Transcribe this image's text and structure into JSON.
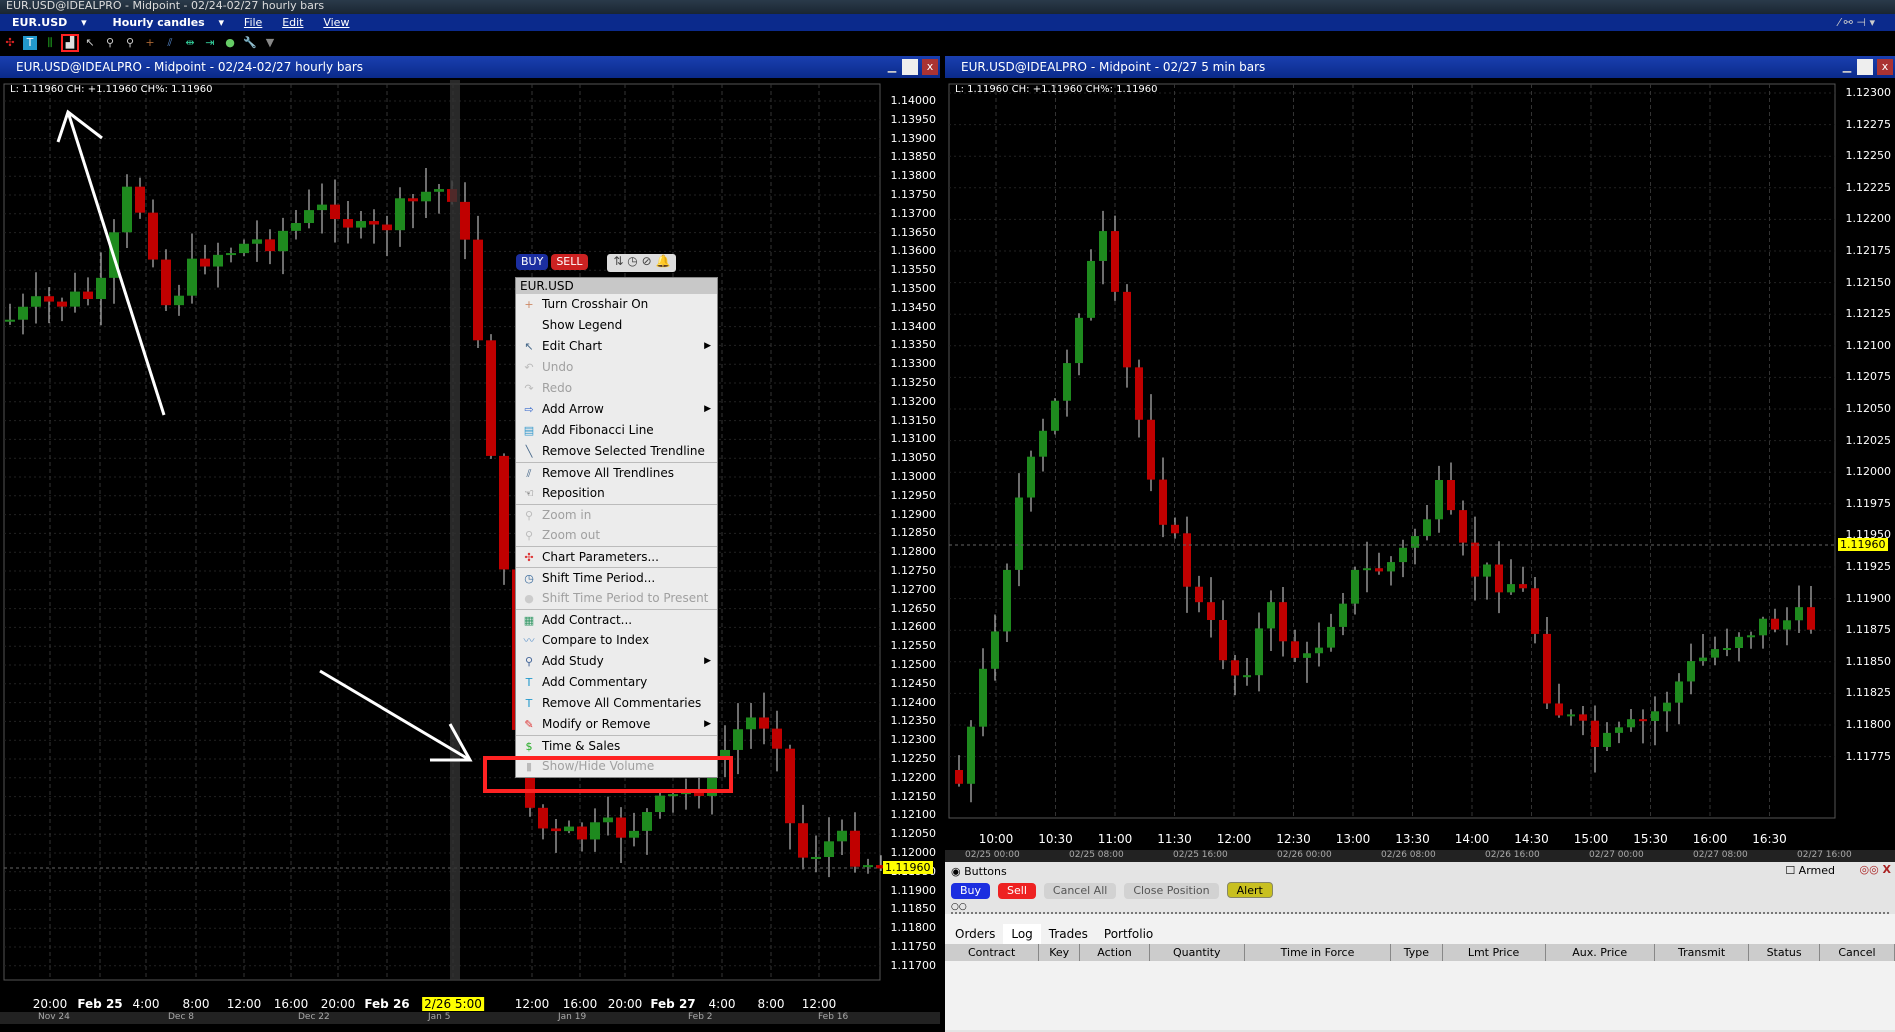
{
  "app": {
    "title": "EUR.USD@IDEALPRO - Midpoint - 02/24-02/27 hourly bars"
  },
  "menubar": {
    "symbol": "EUR.USD",
    "period": "Hourly candles",
    "file": "File",
    "edit": "Edit",
    "view": "View"
  },
  "left_pane": {
    "title": "EUR.USD@IDEALPRO - Midpoint - 02/24-02/27 hourly bars",
    "legend": "L: 1.11960 CH: +1.11960 CH%: 1.11960",
    "price_tag": "1.11960",
    "cursor_time": "2/26 5:00",
    "prices": [
      "1.14000",
      "1.13950",
      "1.13900",
      "1.13850",
      "1.13800",
      "1.13750",
      "1.13700",
      "1.13650",
      "1.13600",
      "1.13550",
      "1.13500",
      "1.13450",
      "1.13400",
      "1.13350",
      "1.13300",
      "1.13250",
      "1.13200",
      "1.13150",
      "1.13100",
      "1.13050",
      "1.13000",
      "1.12950",
      "1.12900",
      "1.12850",
      "1.12800",
      "1.12750",
      "1.12700",
      "1.12650",
      "1.12600",
      "1.12550",
      "1.12500",
      "1.12450",
      "1.12400",
      "1.12350",
      "1.12300",
      "1.12250",
      "1.12200",
      "1.12150",
      "1.12100",
      "1.12050",
      "1.12000",
      "1.11950",
      "1.11900",
      "1.11850",
      "1.11800",
      "1.11750",
      "1.11700"
    ],
    "times": [
      {
        "t": "20:00"
      },
      {
        "t": "Feb 25",
        "b": true
      },
      {
        "t": "4:00"
      },
      {
        "t": "8:00"
      },
      {
        "t": "12:00"
      },
      {
        "t": "16:00"
      },
      {
        "t": "20:00"
      },
      {
        "t": "Feb 26",
        "b": true
      },
      {
        "t": ""
      },
      {
        "t": "12:00"
      },
      {
        "t": "16:00"
      },
      {
        "t": "20:00"
      },
      {
        "t": "Feb 27",
        "b": true
      },
      {
        "t": "4:00"
      },
      {
        "t": "8:00"
      },
      {
        "t": "12:00"
      }
    ],
    "nav": [
      "Nov 24",
      "Dec 8",
      "Dec 22",
      "Jan 5",
      "Jan 19",
      "Feb 2",
      "Feb 16"
    ]
  },
  "right_pane": {
    "title": "EUR.USD@IDEALPRO - Midpoint - 02/27 5 min bars",
    "legend": "L: 1.11960 CH: +1.11960 CH%: 1.11960",
    "price_tag": "1.11960",
    "prices": [
      "1.12300",
      "1.12275",
      "1.12250",
      "1.12225",
      "1.12200",
      "1.12175",
      "1.12150",
      "1.12125",
      "1.12100",
      "1.12075",
      "1.12050",
      "1.12025",
      "1.12000",
      "1.11975",
      "1.11950",
      "1.11925",
      "1.11900",
      "1.11875",
      "1.11850",
      "1.11825",
      "1.11800",
      "1.11775"
    ],
    "times": [
      "10:00",
      "10:30",
      "11:00",
      "11:30",
      "12:00",
      "12:30",
      "13:00",
      "13:30",
      "14:00",
      "14:30",
      "15:00",
      "15:30",
      "16:00",
      "16:30"
    ],
    "nav": [
      "02/25 00:00",
      "02/25 08:00",
      "02/25 16:00",
      "02/26 00:00",
      "02/26 08:00",
      "02/26 16:00",
      "02/27 00:00",
      "02/27 08:00",
      "02/27 16:00"
    ]
  },
  "order_bar": {
    "buy": "BUY",
    "sell": "SELL"
  },
  "context_menu": {
    "header": "EUR.USD",
    "items": [
      {
        "label": "Turn Crosshair On",
        "icon": "crosshair-icon",
        "g": "+",
        "c": "#c86",
        "sep": false
      },
      {
        "label": "Show Legend",
        "icon": "",
        "g": "",
        "c": "#000"
      },
      {
        "label": "Edit Chart",
        "icon": "edit-chart-icon",
        "g": "↖",
        "c": "#468",
        "sub": true
      },
      {
        "label": "Undo",
        "icon": "undo-icon",
        "g": "↶",
        "c": "#bbb",
        "dis": true
      },
      {
        "label": "Redo",
        "icon": "redo-icon",
        "g": "↷",
        "c": "#bbb",
        "dis": true
      },
      {
        "label": "Add Arrow",
        "icon": "arrow-icon",
        "g": "⇨",
        "c": "#36c",
        "sub": true
      },
      {
        "label": "Add Fibonacci Line",
        "icon": "fibonacci-icon",
        "g": "▤",
        "c": "#39c"
      },
      {
        "label": "Remove Selected Trendline",
        "icon": "trendline-icon",
        "g": "╲",
        "c": "#468"
      },
      {
        "label": "Remove All Trendlines",
        "icon": "trendlines-icon",
        "g": "⫽",
        "c": "#468",
        "sep": true
      },
      {
        "label": "Reposition",
        "icon": "hand-icon",
        "g": "☜",
        "c": "#333"
      },
      {
        "label": "Zoom in",
        "icon": "zoom-in-icon",
        "g": "⚲",
        "c": "#bbb",
        "dis": true,
        "sep": true
      },
      {
        "label": "Zoom out",
        "icon": "zoom-out-icon",
        "g": "⚲",
        "c": "#bbb",
        "dis": true
      },
      {
        "label": "Chart Parameters...",
        "icon": "chart-params-icon",
        "g": "✣",
        "c": "#d33",
        "sep": true
      },
      {
        "label": "Shift Time Period...",
        "icon": "shift-time-icon",
        "g": "◷",
        "c": "#369",
        "sep": true
      },
      {
        "label": "Shift Time Period to Present",
        "icon": "shift-present-icon",
        "g": "●",
        "c": "#ccc",
        "dis": true
      },
      {
        "label": "Add Contract...",
        "icon": "add-contract-icon",
        "g": "▦",
        "c": "#396",
        "sep": true
      },
      {
        "label": "Compare to Index",
        "icon": "compare-icon",
        "g": "〰",
        "c": "#69c"
      },
      {
        "label": "Add Study",
        "icon": "study-icon",
        "g": "⚲",
        "c": "#469",
        "sub": true
      },
      {
        "label": "Add Commentary",
        "icon": "commentary-icon",
        "g": "T",
        "c": "#29c"
      },
      {
        "label": "Remove All Commentaries",
        "icon": "remove-commentary-icon",
        "g": "T",
        "c": "#29c"
      },
      {
        "label": "Modify or Remove",
        "icon": "pencil-icon",
        "g": "✎",
        "c": "#d33",
        "sub": true
      },
      {
        "label": "Time & Sales",
        "icon": "time-sales-icon",
        "g": "$",
        "c": "#2a2",
        "sep": true
      },
      {
        "label": "Show/Hide Volume",
        "icon": "volume-icon",
        "g": "▮",
        "c": "#bbb",
        "dis": true
      }
    ]
  },
  "bottom": {
    "section": "Buttons",
    "armed": "Armed",
    "buttons": [
      "Buy",
      "Sell",
      "Cancel All",
      "Close Position",
      "Alert"
    ],
    "tabs": [
      "Orders",
      "Log",
      "Trades",
      "Portfolio"
    ],
    "columns": [
      "Contract",
      "Key",
      "Action",
      "Quantity",
      "Time in Force",
      "Type",
      "Lmt Price",
      "Aux. Price",
      "Transmit",
      "Status",
      "Cancel"
    ]
  },
  "colors": {
    "up": "#1e8a1e",
    "down": "#c00000",
    "highlight": "#ff2020",
    "title_blue": "#0b2a8c"
  }
}
